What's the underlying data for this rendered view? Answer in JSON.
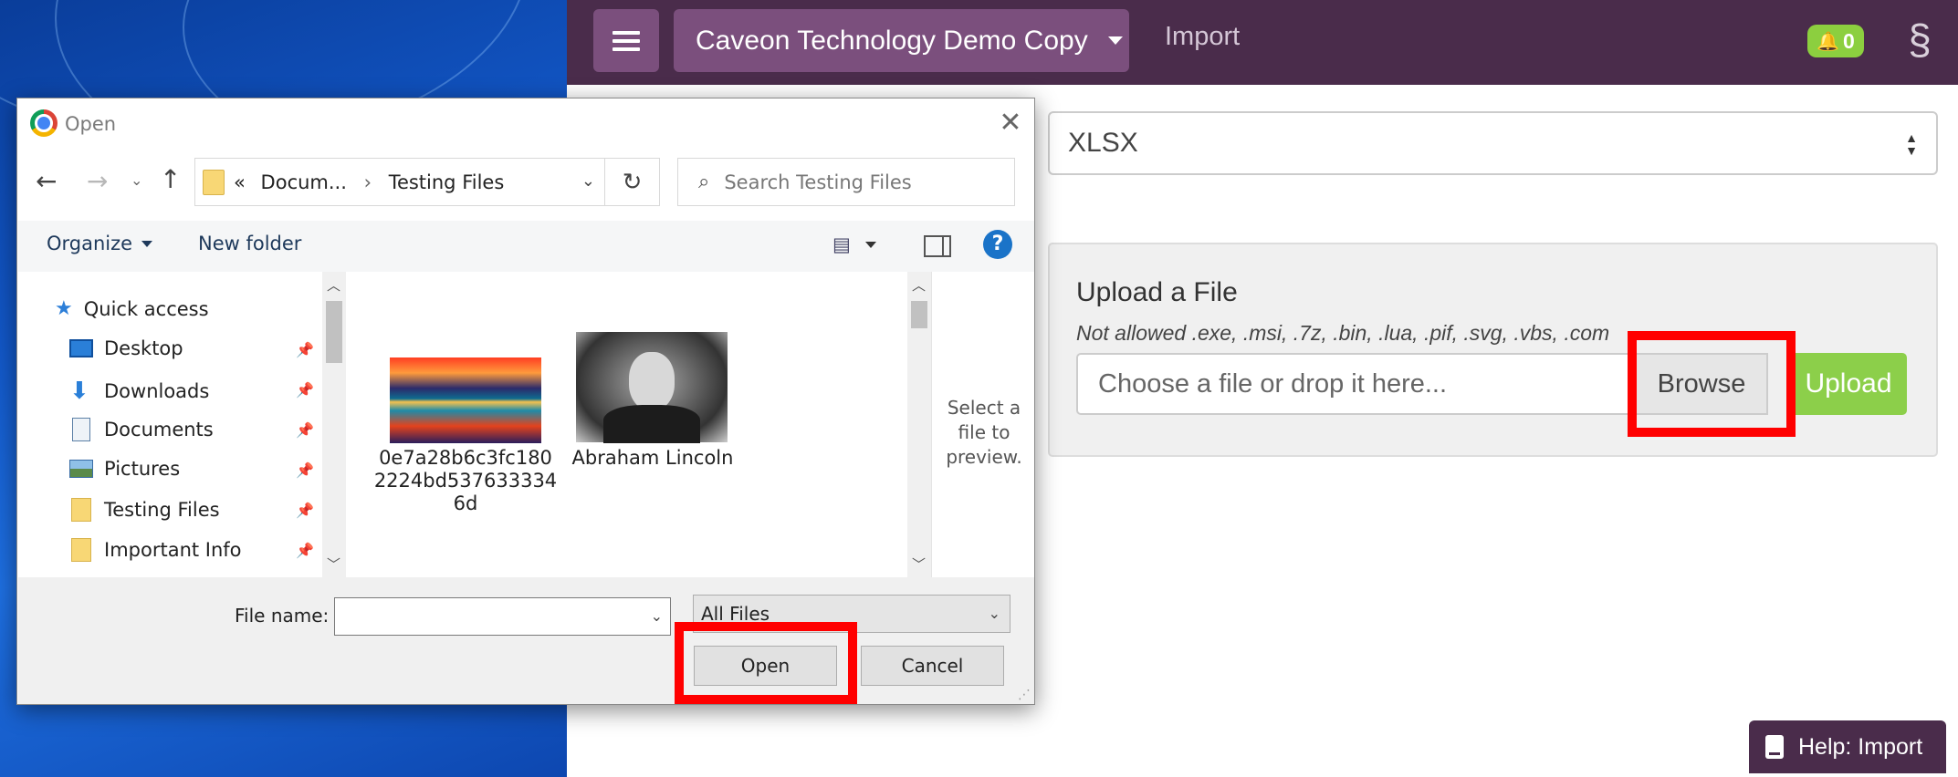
{
  "app": {
    "menu_icon": "hamburger-icon",
    "org_name": "Caveon Technology Demo Copy",
    "nav_import": "Import",
    "notification_count": "0",
    "brand_color": "#4a2c4b",
    "accent_color": "#7b4f7d",
    "success_color": "#8ccf4a"
  },
  "format_select": {
    "value": "XLSX"
  },
  "upload": {
    "title": "Upload a File",
    "note": "Not allowed .exe, .msi, .7z, .bin, .lua, .pif, .svg, .vbs, .com",
    "placeholder": "Choose a file or drop it here...",
    "browse_label": "Browse",
    "upload_label": "Upload"
  },
  "help": {
    "label": "Help: Import"
  },
  "dialog": {
    "title": "Open",
    "address": {
      "chevrons": "«",
      "segments": [
        "Docum...",
        "Testing Files"
      ],
      "separator": "›"
    },
    "search_placeholder": "Search Testing Files",
    "toolbar": {
      "organize_label": "Organize",
      "new_folder_label": "New folder",
      "help_label": "?"
    },
    "nav": {
      "quick_access": "Quick access",
      "items": [
        {
          "label": "Desktop",
          "icon": "desktop-icon"
        },
        {
          "label": "Downloads",
          "icon": "downloads-icon"
        },
        {
          "label": "Documents",
          "icon": "documents-icon"
        },
        {
          "label": "Pictures",
          "icon": "pictures-icon"
        },
        {
          "label": "Testing Files",
          "icon": "folder-icon"
        },
        {
          "label": "Important Info",
          "icon": "folder-icon"
        }
      ]
    },
    "files": [
      {
        "name": "0e7a28b6c3fc180\n2224bd537633334\n6d"
      },
      {
        "name": "Abraham Lincoln"
      }
    ],
    "preview_text": "Select a file to preview.",
    "file_name_label": "File name:",
    "file_name_value": "",
    "file_type": "All Files",
    "open_label": "Open",
    "cancel_label": "Cancel"
  }
}
